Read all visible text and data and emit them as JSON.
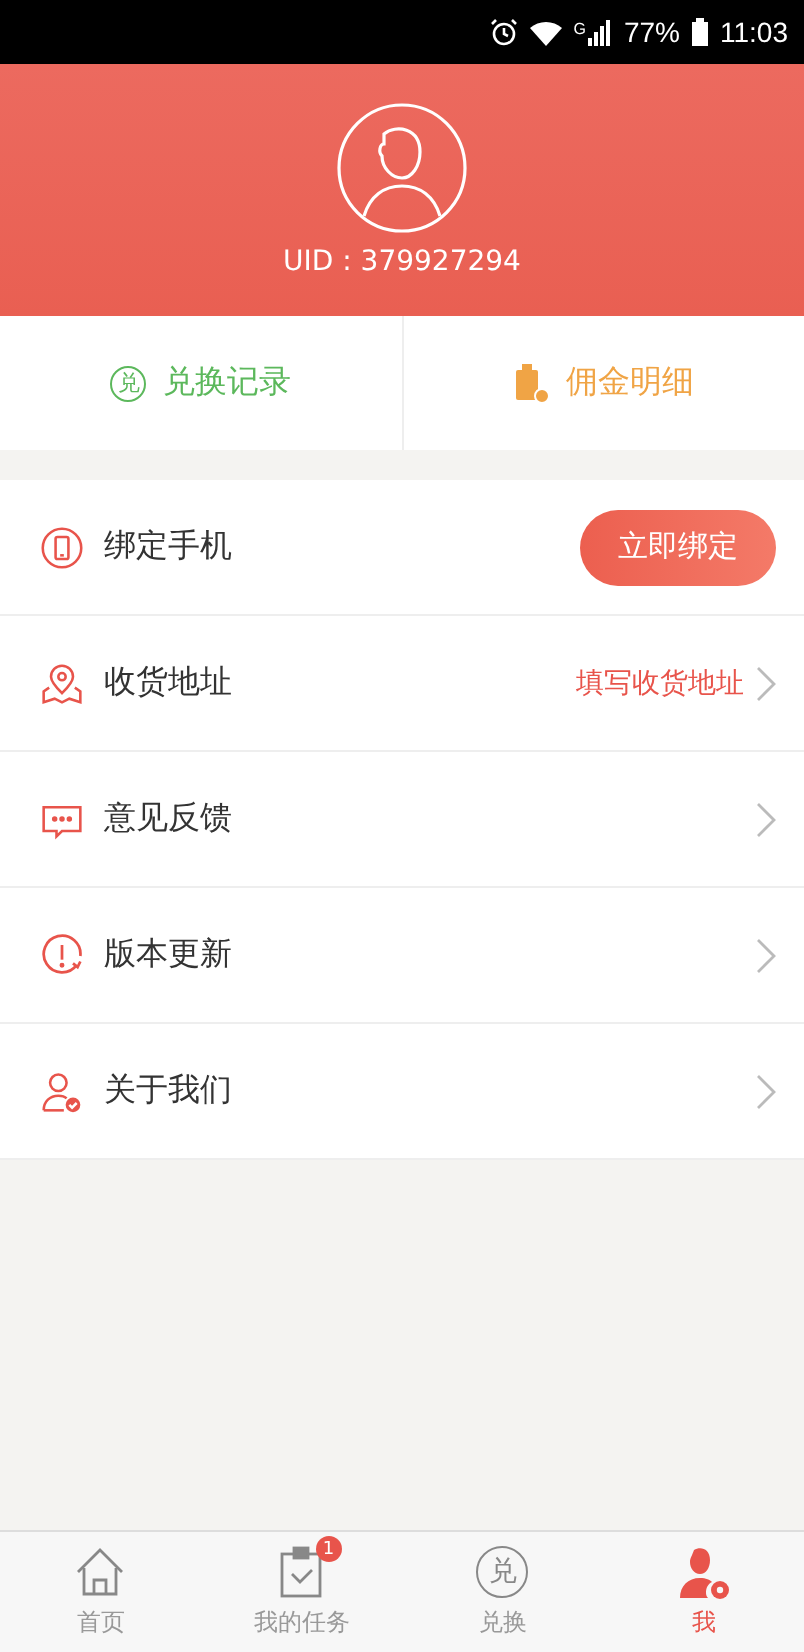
{
  "status_bar": {
    "battery": "77%",
    "time": "11:03",
    "network": "G"
  },
  "profile": {
    "uid": "UID : 379927294"
  },
  "quick_actions": [
    {
      "kind": "exchange",
      "icon_text": "兑",
      "label": "兑换记录",
      "color": "#5cb85c"
    },
    {
      "kind": "commission",
      "label": "佣金明细",
      "color": "#f0a445"
    }
  ],
  "menu": [
    {
      "kind": "button",
      "label": "绑定手机",
      "action": "立即绑定"
    },
    {
      "kind": "link",
      "label": "收货地址",
      "value": "填写收货地址"
    },
    {
      "kind": "link",
      "label": "意见反馈"
    },
    {
      "kind": "link",
      "label": "版本更新"
    },
    {
      "kind": "link",
      "label": "关于我们"
    }
  ],
  "tabs": [
    {
      "label": "首页",
      "selected": false
    },
    {
      "label": "我的任务",
      "badge": "1",
      "selected": false
    },
    {
      "icon_text": "兑",
      "label": "兑换",
      "selected": false
    },
    {
      "label": "我",
      "selected": true
    }
  ]
}
